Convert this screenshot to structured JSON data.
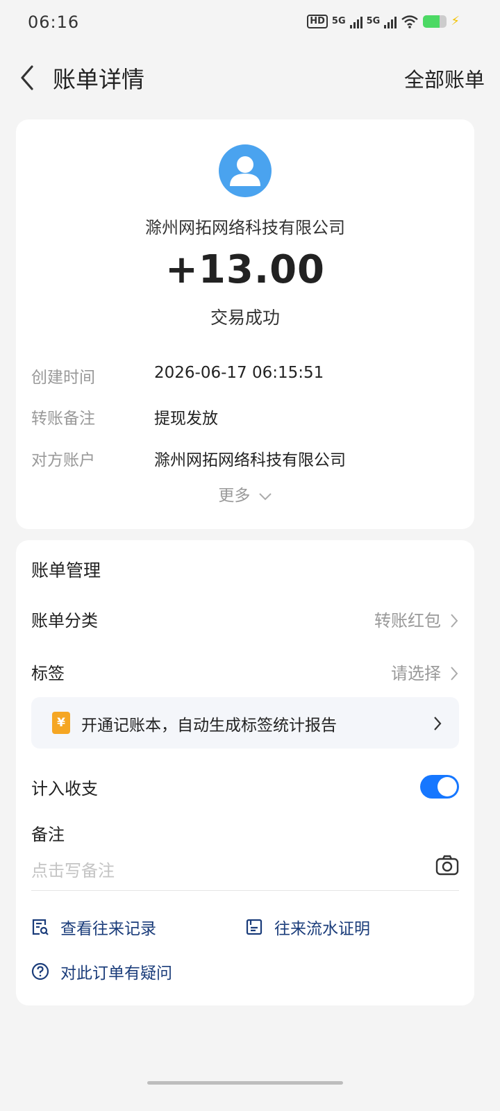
{
  "status_bar": {
    "time": "06:16",
    "hd_label": "HD",
    "net1": "5G",
    "net2": "5G",
    "battery_level_fraction": 0.7
  },
  "header": {
    "title": "账单详情",
    "all_bills": "全部账单"
  },
  "summary": {
    "company": "滁州网拓网络科技有限公司",
    "amount": "+13.00",
    "status": "交易成功"
  },
  "details": [
    {
      "label": "创建时间",
      "value": "2026-06-17 06:15:51"
    },
    {
      "label": "转账备注",
      "value": "提现发放"
    },
    {
      "label": "对方账户",
      "value": "滁州网拓网络科技有限公司"
    }
  ],
  "more_label": "更多",
  "management": {
    "title": "账单管理",
    "category_label": "账单分类",
    "category_value": "转账红包",
    "tag_label": "标签",
    "tag_value": "请选择",
    "promo_icon": "¥",
    "promo_text": "开通记账本，自动生成标签统计报告",
    "include_label": "计入收支",
    "include_on": true,
    "memo_label": "备注",
    "memo_placeholder": "点击写备注"
  },
  "links": {
    "history": "查看往来记录",
    "proof": "往来流水证明",
    "question": "对此订单有疑问"
  },
  "colors": {
    "accent": "#1677ff",
    "link": "#1a3c7a",
    "avatar": "#4aa3ef",
    "promo_icon": "#f5a623"
  }
}
